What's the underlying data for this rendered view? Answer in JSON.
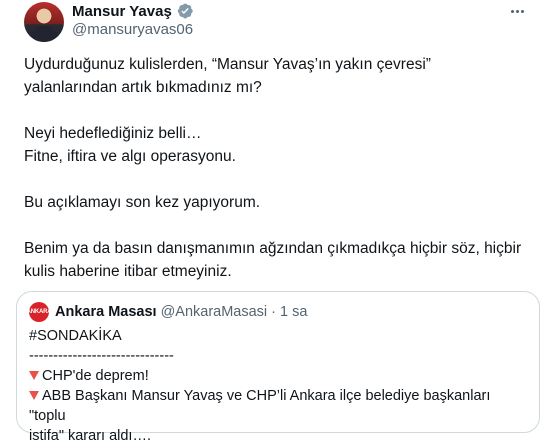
{
  "author": {
    "display_name": "Mansur Yavaş",
    "handle": "@mansuryavas06",
    "verified_color": "#829aab"
  },
  "tweet": {
    "paragraphs": [
      [
        "Uydurduğunuz kulislerden, “Mansur Yavaş’ın yakın çevresi”",
        "yalanlarından artık bıkmadınız mı?"
      ],
      [
        "Neyi hedeflediğiniz belli…",
        "Fitne, iftira ve algı operasyonu."
      ],
      [
        "Bu açıklamayı son kez yapıyorum."
      ],
      [
        "Benim ya da basın danışmanımın ağzından çıkmadıkça hiçbir söz, hiçbir",
        "kulis haberine itibar etmeyiniz."
      ]
    ]
  },
  "quote": {
    "avatar_text": "ANKARA",
    "display_name": "Ankara Masası",
    "handle": "@AnkaraMasasi",
    "separator": "·",
    "time": "1 sa",
    "lines": [
      "#SONDAKİKA",
      "------------------------------",
      "CHP'de deprem!",
      "ABB Başkanı Mansur Yavaş ve CHP’li Ankara ilçe belediye başkanları \"toplu",
      "istifa\" kararı aldı…."
    ],
    "marker_color": "#e5534b"
  }
}
